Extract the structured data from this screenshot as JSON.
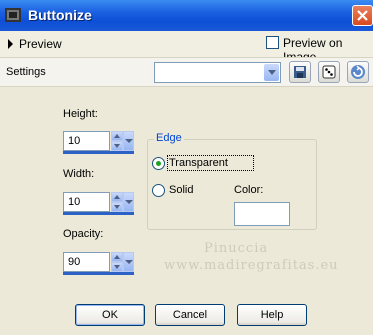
{
  "window": {
    "title": "Buttonize",
    "icon": "app-icon",
    "close_icon": "close-icon"
  },
  "preview": {
    "label": "Preview",
    "preview_on_image_label": "Preview on Image",
    "preview_on_image_checked": false
  },
  "settings": {
    "label": "Settings",
    "preset_value": "",
    "buttons": [
      "save-preset-icon",
      "random-dice-icon",
      "reset-icon"
    ]
  },
  "fields": {
    "height": {
      "label": "Height:",
      "value": "10"
    },
    "width": {
      "label": "Width:",
      "value": "10"
    },
    "opacity": {
      "label": "Opacity:",
      "value": "90"
    }
  },
  "edge": {
    "title": "Edge",
    "options": [
      {
        "label": "Transparent",
        "selected": true
      },
      {
        "label": "Solid",
        "selected": false
      }
    ],
    "color_label": "Color:",
    "color_value": "#ffffff"
  },
  "watermark": {
    "line1": "Pinuccia",
    "line2": "www.madiregrafitas.eu"
  },
  "buttons": {
    "ok": "OK",
    "cancel": "Cancel",
    "help": "Help"
  },
  "colors": {
    "titlebar": "#0d4fd6",
    "accent": "#2c62c6",
    "group_title": "#0046d5",
    "dialog_bg": "#ece9d8"
  }
}
